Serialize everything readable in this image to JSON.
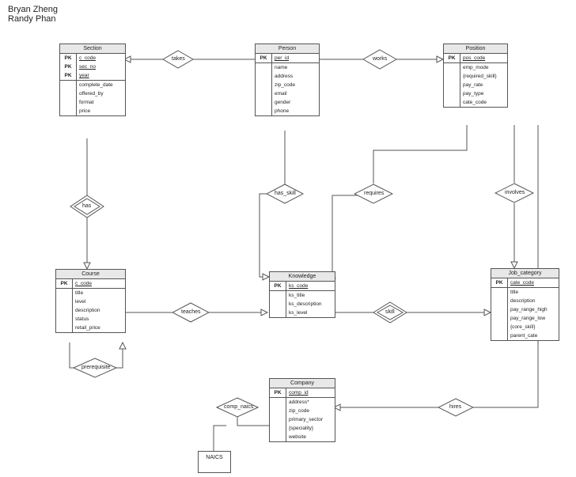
{
  "authors": [
    "Bryan Zheng",
    "Randy Phan"
  ],
  "entities": {
    "section": {
      "title": "Section",
      "pk": [
        "c_code",
        "sec_no",
        "year"
      ],
      "attrs": [
        "complete_date",
        "offered_by",
        "format",
        "price"
      ]
    },
    "person": {
      "title": "Person",
      "pk": [
        "per_id"
      ],
      "attrs": [
        "name",
        "address",
        "zip_code",
        "email",
        "gender",
        "phone"
      ]
    },
    "position": {
      "title": "Position",
      "pk": [
        "pos_code"
      ],
      "attrs": [
        "emp_mode",
        "{required_skill}",
        "pay_rate",
        "pay_type",
        "cate_code"
      ]
    },
    "course": {
      "title": "Course",
      "pk": [
        "c_code"
      ],
      "attrs": [
        "title",
        "level",
        "description",
        "status",
        "retail_price"
      ]
    },
    "knowledge": {
      "title": "Knowledge",
      "pk": [
        "ks_code"
      ],
      "attrs": [
        "ks_title",
        "ks_description",
        "ks_level"
      ]
    },
    "jobcat": {
      "title": "Job_category",
      "pk": [
        "cate_code"
      ],
      "attrs": [
        "title",
        "description",
        "pay_range_high",
        "pay_range_low",
        "{core_skill}",
        "parent_cate"
      ]
    },
    "company": {
      "title": "Company",
      "pk": [
        "comp_id"
      ],
      "attrs": [
        "address*",
        "zip_code",
        "primary_sector",
        "{speciality}",
        "website"
      ]
    }
  },
  "relationships": {
    "takes": "takes",
    "works": "works",
    "has": "has",
    "has_skill": "has_skill",
    "requires": "requires",
    "involves": "involves",
    "teaches": "teaches",
    "skill": "skill",
    "prerequisite": "prerequisite",
    "comp_naics": "comp_naics",
    "hires": "hires"
  },
  "misc": {
    "naics": "NAICS"
  }
}
